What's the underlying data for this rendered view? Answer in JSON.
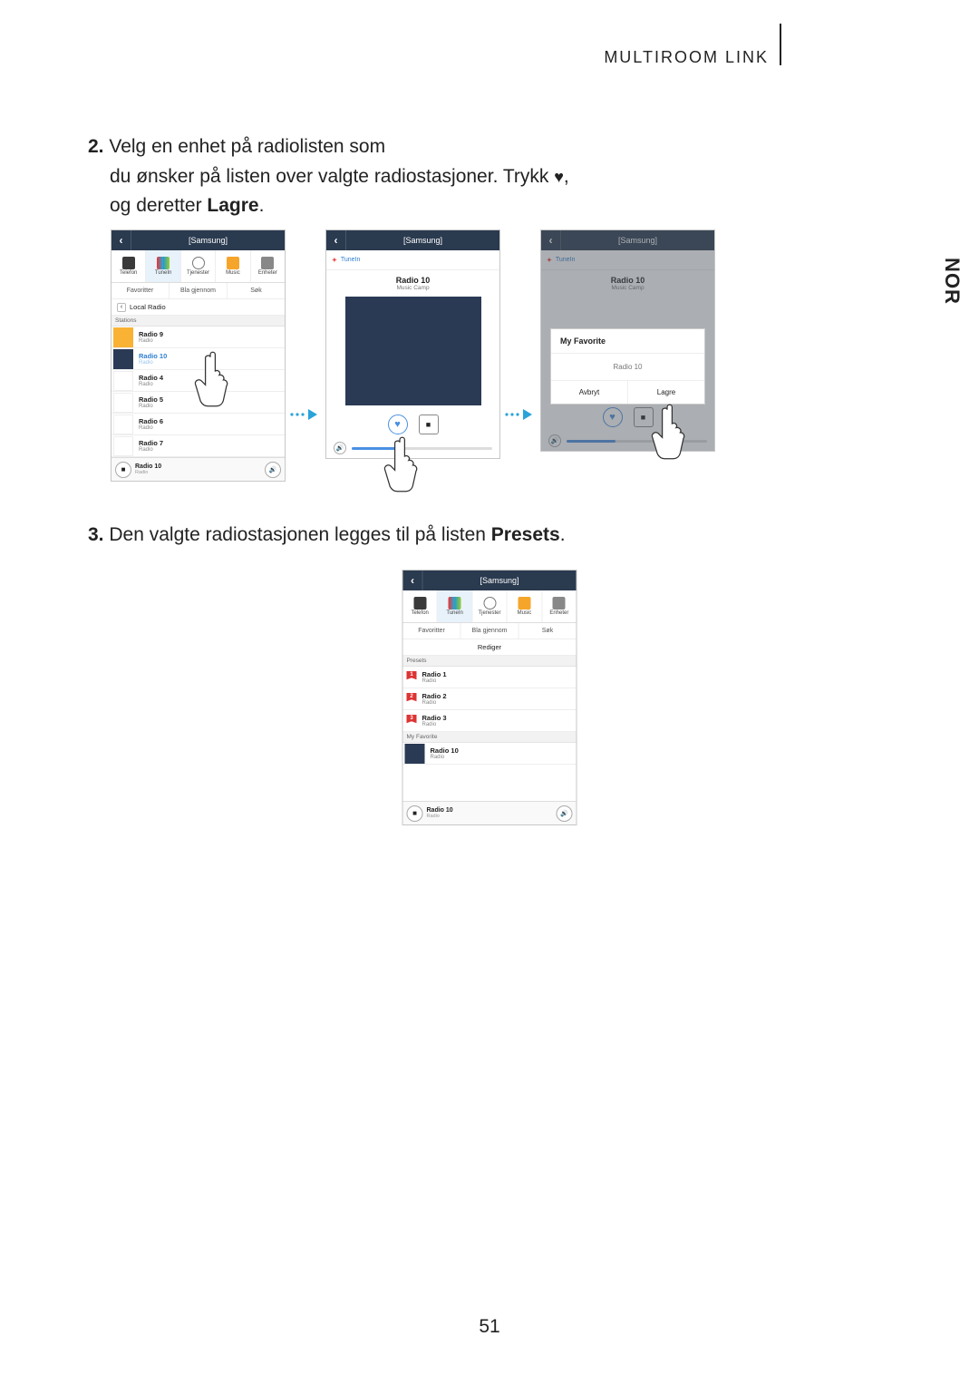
{
  "header": {
    "title": "MULTIROOM LINK",
    "lang_tab": "NOR",
    "page_number": "51"
  },
  "step2": {
    "num": "2.",
    "line1": "Velg en enhet på radiolisten som",
    "line2a": "du ønsker på listen over valgte radiostasjoner. Trykk ",
    "line2b": ",",
    "line3a": "og deretter ",
    "line3_bold": "Lagre",
    "line3b": "."
  },
  "step3": {
    "num": "3.",
    "text_a": "Den valgte radiostasjonen legges til på listen ",
    "bold": "Presets",
    "text_b": "."
  },
  "phone_header": "[Samsung]",
  "tabs": {
    "telefon": "Telefon",
    "tunein": "TuneIn",
    "tjenester": "Tjenester",
    "music": "Music",
    "enheter": "Enheter"
  },
  "subtabs": {
    "favoritter": "Favoritter",
    "bla": "Bla gjennom",
    "sok": "Søk"
  },
  "screen1": {
    "crumb": "Local Radio",
    "section": "Stations",
    "rows": [
      {
        "t": "Radio 9",
        "s": "Radio",
        "thumb": "orange"
      },
      {
        "t": "Radio 10",
        "s": "Radio",
        "thumb": "navy",
        "selected": true
      },
      {
        "t": "Radio 4",
        "s": "Radio",
        "thumb": "white"
      },
      {
        "t": "Radio 5",
        "s": "Radio",
        "thumb": "white"
      },
      {
        "t": "Radio 6",
        "s": "Radio",
        "thumb": "white"
      },
      {
        "t": "Radio 7",
        "s": "Radio",
        "thumb": "white"
      }
    ],
    "footer": {
      "title": "Radio 10",
      "sub": "Radio"
    }
  },
  "screen2": {
    "tunein": "TuneIn",
    "np_title": "Radio 10",
    "np_sub": "Music Camp"
  },
  "screen3": {
    "tunein": "TuneIn",
    "np_title": "Radio 10",
    "np_sub": "Music Camp",
    "popup": {
      "header": "My Favorite",
      "item": "Radio 10",
      "cancel": "Avbryt",
      "save": "Lagre"
    }
  },
  "screen4": {
    "rediger": "Rediger",
    "presets_label": "Presets",
    "presets": [
      {
        "n": "1",
        "t": "Radio 1",
        "s": "Radio"
      },
      {
        "n": "2",
        "t": "Radio 2",
        "s": "Radio"
      },
      {
        "n": "3",
        "t": "Radio 3",
        "s": "Radio"
      }
    ],
    "fav_label": "My Favorite",
    "fav": {
      "t": "Radio 10",
      "s": "Radio"
    },
    "footer": {
      "title": "Radio 10",
      "sub": "Radio"
    }
  }
}
